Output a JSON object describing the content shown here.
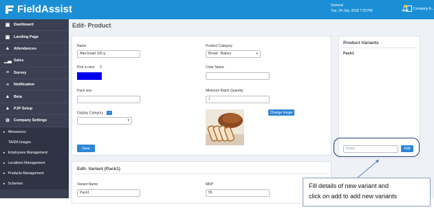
{
  "header": {
    "app_name": "FieldAssist",
    "context_line1": "General",
    "context_line2": "Tue, 24 July, 2018 7:20 PM",
    "user_name": "Company A..."
  },
  "sidebar": {
    "items": [
      {
        "label": "Dashboard",
        "icon": "monitor-icon"
      },
      {
        "label": "Landing Page",
        "icon": "monitor-icon"
      },
      {
        "label": "Attendances",
        "icon": "person-icon"
      },
      {
        "label": "Sales",
        "icon": "bar-chart-icon"
      },
      {
        "label": "Survey",
        "icon": "sliders-icon"
      },
      {
        "label": "Notification",
        "icon": "sliders-icon"
      },
      {
        "label": "Beta",
        "icon": "person-icon"
      },
      {
        "label": "PJP Setup",
        "icon": "person-icon"
      },
      {
        "label": "Company Settings",
        "icon": "gears-icon"
      }
    ],
    "sub_items": [
      {
        "label": "Allowances",
        "caret": true
      },
      {
        "label": "TA/DA Images",
        "caret": false
      },
      {
        "label": "Employees Management",
        "caret": true
      },
      {
        "label": "Locations Management",
        "caret": true
      },
      {
        "label": "Products Management",
        "caret": true
      },
      {
        "label": "Schemes",
        "caret": true
      }
    ]
  },
  "page": {
    "title": "Edit- Product"
  },
  "product_form": {
    "name_label": "Name",
    "name_value": "Atta bread 100 g",
    "category_label": "Product Category",
    "category_value": "Bread - Bakery",
    "color_label": "Pick a color",
    "color_value": "0",
    "swatch_color": "#0000ee",
    "color_name_label": "Color Name",
    "color_name_value": "",
    "pack_size_label": "Pack size",
    "pack_size_value": "",
    "min_batch_label": "Minimum Batch Quantity",
    "min_batch_value": "1",
    "display_category_label": "Display Category",
    "display_category_badge": "+",
    "display_category_value": "",
    "change_image_label": "Change Image",
    "save_label": "Save"
  },
  "variant_form": {
    "title": "Edit- Variant  (Pack1)",
    "variant_name_label": "Variant Name",
    "variant_name_value": "Pack1",
    "mrp_label": "MRP",
    "mrp_value": "55"
  },
  "variants_panel": {
    "title": "Product Variants",
    "items": [
      "Pack1"
    ],
    "name_placeholder": "Name",
    "add_label": "Add"
  },
  "callout": {
    "text_line1": "Fill details of new variant and",
    "text_line2": "click on add to add new variants"
  },
  "colors": {
    "header_blue": "#1b8fd6",
    "sidebar_dark": "#3a3f51",
    "button_blue": "#2f86d6",
    "callout_navy": "#1d3f78"
  }
}
